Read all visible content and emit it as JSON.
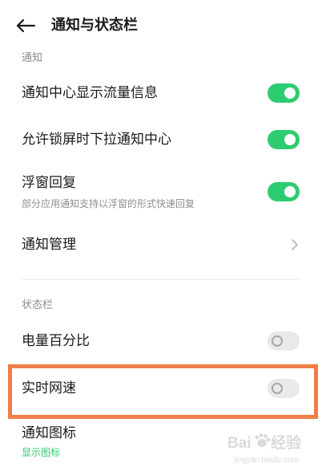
{
  "header": {
    "title": "通知与状态栏"
  },
  "sections": {
    "notifications": {
      "label": "通知"
    },
    "status_bar": {
      "label": "状态栏"
    }
  },
  "rows": {
    "traffic_info": {
      "label": "通知中心显示流量信息",
      "enabled": true
    },
    "lockscreen_pull": {
      "label": "允许锁屏时下拉通知中心",
      "enabled": true
    },
    "float_reply": {
      "label": "浮窗回复",
      "subtitle": "部分应用通知支持以浮窗的形式快速回复",
      "enabled": true
    },
    "notification_manage": {
      "label": "通知管理"
    },
    "battery_percent": {
      "label": "电量百分比",
      "enabled": false
    },
    "realtime_speed": {
      "label": "实时网速",
      "enabled": false
    },
    "notification_icon": {
      "label": "通知图标",
      "value": "显示图标"
    }
  },
  "watermark": {
    "text": "Baidu 经验",
    "sub": "jingyan.baidu.com"
  },
  "colors": {
    "accent": "#2ecc71",
    "highlight": "#ef7d47"
  }
}
